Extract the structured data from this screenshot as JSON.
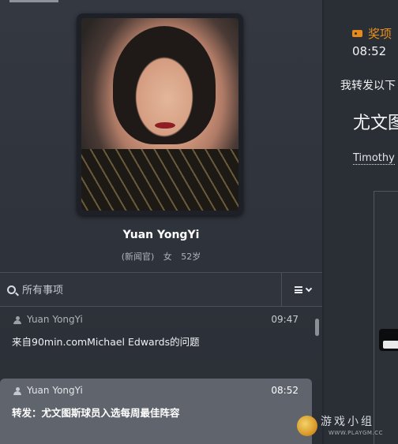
{
  "profile": {
    "name": "Yuan YongYi",
    "role": "(新闻官)",
    "gender": "女",
    "age": "52岁"
  },
  "search": {
    "placeholder": "所有事项"
  },
  "messages": [
    {
      "sender": "Yuan YongYi",
      "time": "09:47",
      "text": "来自90min.comMichael Edwards的问题"
    },
    {
      "sender": "Yuan YongYi",
      "time": "08:52",
      "text": "转发：尤文图斯球员入选每周最佳阵容"
    }
  ],
  "detail": {
    "category": "奖项",
    "time": "08:52",
    "forward_text": "我转发以下",
    "title": "尤文图",
    "author": "Timothy"
  },
  "watermark": {
    "text": "游戏小组",
    "url": "WWW.PLAYGM.CC"
  },
  "colors": {
    "accent": "#e8901c",
    "selected_row": "#60646c",
    "background": "#2b2f37"
  }
}
